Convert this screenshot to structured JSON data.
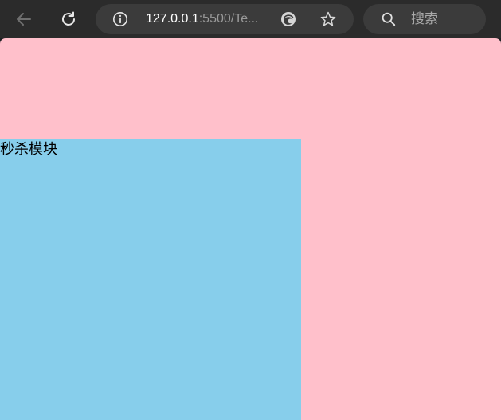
{
  "browser": {
    "url_host": "127.0.0.1",
    "url_rest": ":5500/Te...",
    "search_placeholder": "搜索",
    "icons": {
      "back": "back-arrow-icon",
      "refresh": "refresh-icon",
      "info": "info-icon",
      "edge": "edge-icon",
      "favorite": "star-icon",
      "search": "search-icon"
    }
  },
  "page": {
    "background_color": "#ffc0cb",
    "seckill": {
      "title": "秒杀模块",
      "background_color": "#87ceeb"
    }
  }
}
